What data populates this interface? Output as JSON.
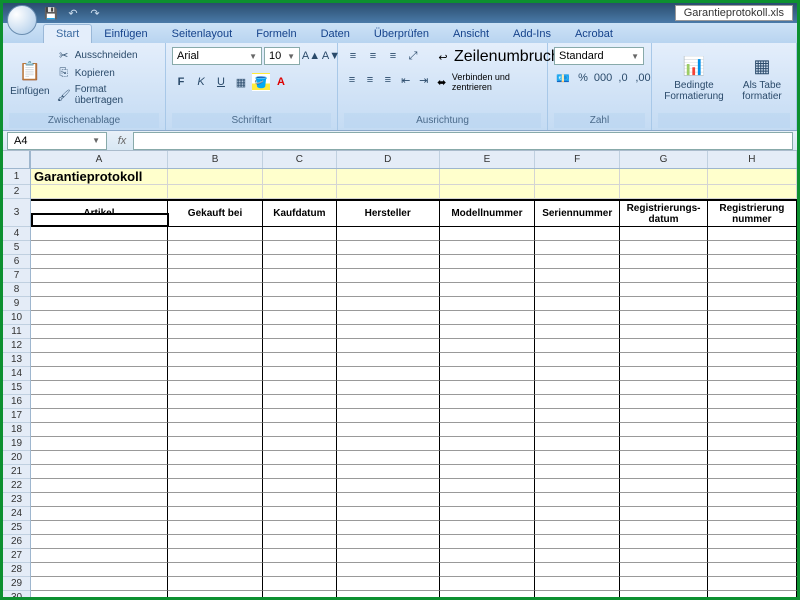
{
  "window": {
    "filename": "Garantieprotokoll.xls"
  },
  "tabs": [
    "Start",
    "Einfügen",
    "Seitenlayout",
    "Formeln",
    "Daten",
    "Überprüfen",
    "Ansicht",
    "Add-Ins",
    "Acrobat"
  ],
  "active_tab": "Start",
  "ribbon": {
    "clipboard": {
      "label": "Zwischenablage",
      "paste": "Einfügen",
      "cut": "Ausschneiden",
      "copy": "Kopieren",
      "format_painter": "Format übertragen"
    },
    "font": {
      "label": "Schriftart",
      "font_name": "Arial",
      "font_size": "10"
    },
    "alignment": {
      "label": "Ausrichtung",
      "wrap": "Zeilenumbruch",
      "merge": "Verbinden und zentrieren"
    },
    "number": {
      "label": "Zahl",
      "format": "Standard"
    },
    "styles": {
      "conditional": "Bedingte Formatierung",
      "as_table": "Als Tabe formatier"
    }
  },
  "namebox": "A4",
  "sheet": {
    "title": "Garantieprotokoll",
    "columns": [
      "A",
      "B",
      "C",
      "D",
      "E",
      "F",
      "G",
      "H"
    ],
    "headers": [
      "Artikel",
      "Gekauft bei",
      "Kaufdatum",
      "Hersteller",
      "Modellnummer",
      "Seriennummer",
      "Registrierungs-datum",
      "Registrierung nummer"
    ],
    "row_count": 30
  }
}
